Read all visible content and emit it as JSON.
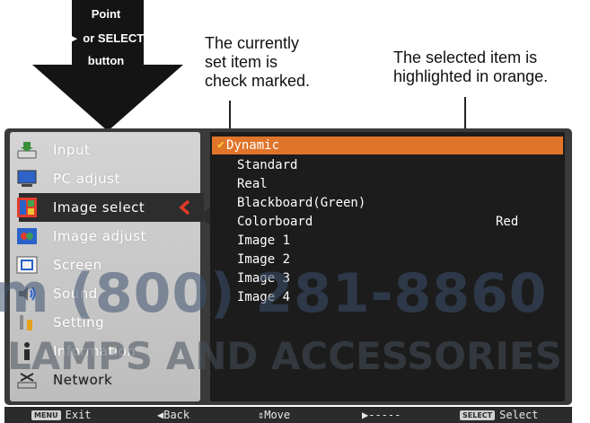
{
  "instruction": {
    "arrow_lines": [
      "Point",
      "► or SELECT",
      "button"
    ],
    "callout_left": [
      "The currently",
      "set item is",
      "check marked."
    ],
    "callout_right": [
      "The selected item is",
      "highlighted in orange."
    ]
  },
  "sidebar": {
    "items": [
      {
        "label": "Input",
        "icon": "input-icon"
      },
      {
        "label": "PC adjust",
        "icon": "pc-adjust-icon"
      },
      {
        "label": "Image select",
        "icon": "image-select-icon",
        "active": true
      },
      {
        "label": "Image adjust",
        "icon": "image-adjust-icon"
      },
      {
        "label": "Screen",
        "icon": "screen-icon"
      },
      {
        "label": "Sound",
        "icon": "sound-icon"
      },
      {
        "label": "Setting",
        "icon": "setting-icon"
      },
      {
        "label": "Information",
        "icon": "information-icon"
      },
      {
        "label": "Network",
        "icon": "network-icon"
      }
    ]
  },
  "options": {
    "items": [
      {
        "label": "Dynamic",
        "checked": true,
        "highlighted": true
      },
      {
        "label": "Standard"
      },
      {
        "label": "Real"
      },
      {
        "label": "Blackboard(Green)"
      },
      {
        "label": "Colorboard",
        "value": "Red"
      },
      {
        "label": "Image 1"
      },
      {
        "label": "Image 2"
      },
      {
        "label": "Image 3"
      },
      {
        "label": "Image 4"
      }
    ],
    "check_mark": "✔"
  },
  "statusbar": {
    "exit_key": "MENU",
    "exit_label": "Exit",
    "back_label": "◀Back",
    "move_label": "⇕Move",
    "next_label": "▶-----",
    "select_key": "SELECT",
    "select_label": "Select"
  },
  "watermark": {
    "phone": "m (800) 281-8860",
    "brand": "LAMPS AND ACCESSORIES"
  },
  "colors": {
    "highlight": "#e0752a",
    "check": "#ffd23a",
    "active_chevron": "#e03a2a",
    "panel": "#1c1c1c",
    "sidebar": "#c8c8c8"
  }
}
